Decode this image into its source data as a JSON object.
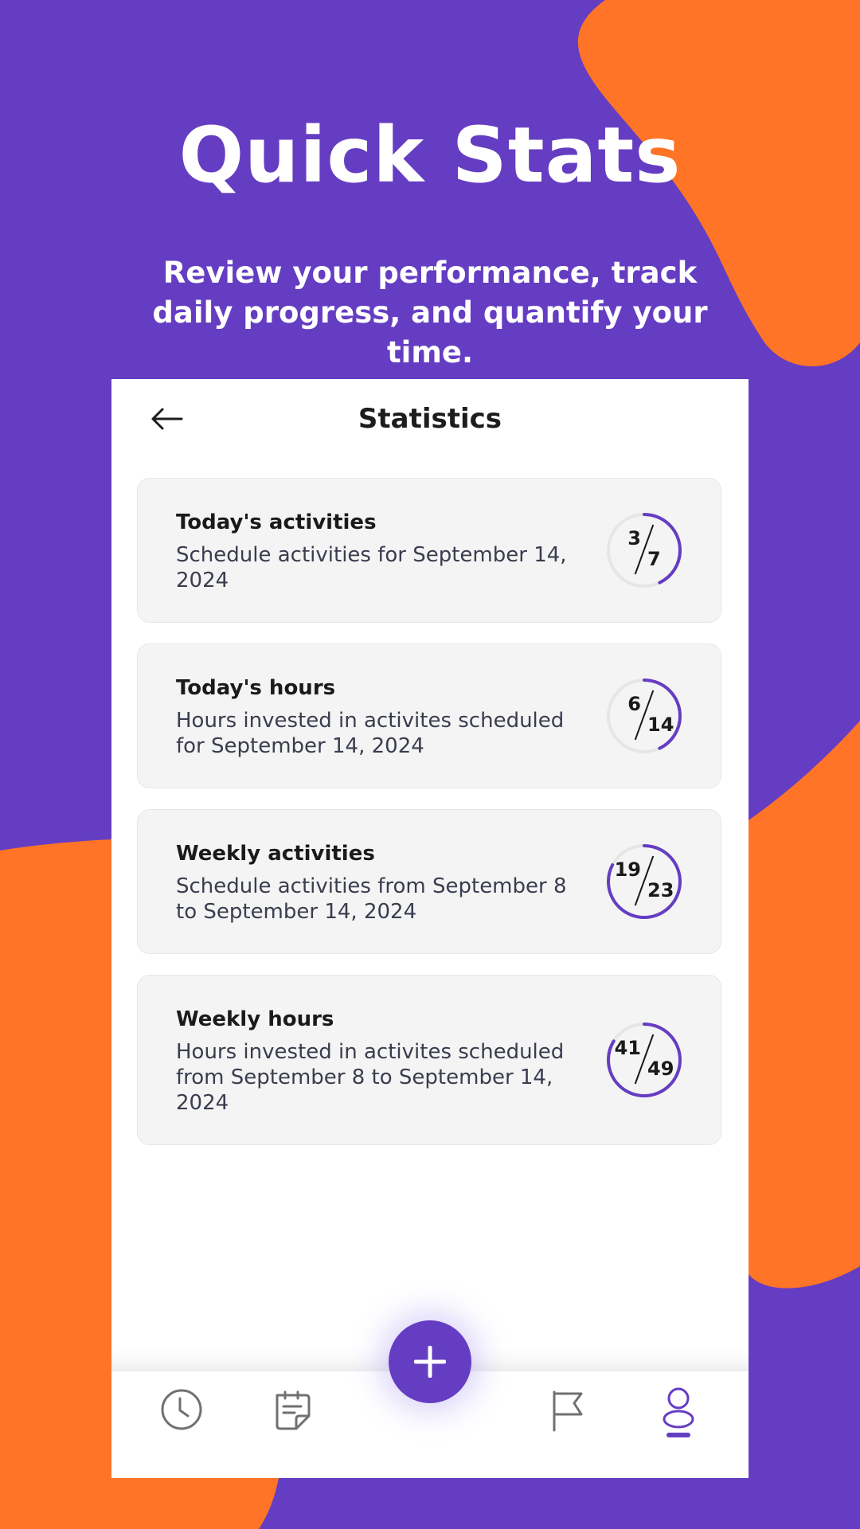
{
  "hero": {
    "title": "Quick Stats",
    "subtitle": "Review your performance, track daily progress, and quantify your time."
  },
  "app": {
    "title": "Statistics",
    "back_icon": "arrow-left-icon"
  },
  "cards": [
    {
      "title": "Today's activities",
      "description": "Schedule activities for September 14, 2024",
      "done": "3",
      "total": "7"
    },
    {
      "title": "Today's hours",
      "description": "Hours invested in activites scheduled for September 14, 2024",
      "done": "6",
      "total": "14"
    },
    {
      "title": "Weekly activities",
      "description": "Schedule activities from September 8 to September 14, 2024",
      "done": "19",
      "total": "23"
    },
    {
      "title": "Weekly hours",
      "description": "Hours invested in activites scheduled from September 8 to September 14, 2024",
      "done": "41",
      "total": "49"
    }
  ],
  "nav": {
    "items": [
      "clock-icon",
      "notes-icon",
      "flag-icon",
      "profile-icon"
    ],
    "active": "profile-icon",
    "fab_icon": "plus-icon"
  },
  "colors": {
    "primary": "#653DC2",
    "accent": "#FF7426",
    "card_bg": "#F4F4F4",
    "ring_track": "#E6E6E6"
  }
}
